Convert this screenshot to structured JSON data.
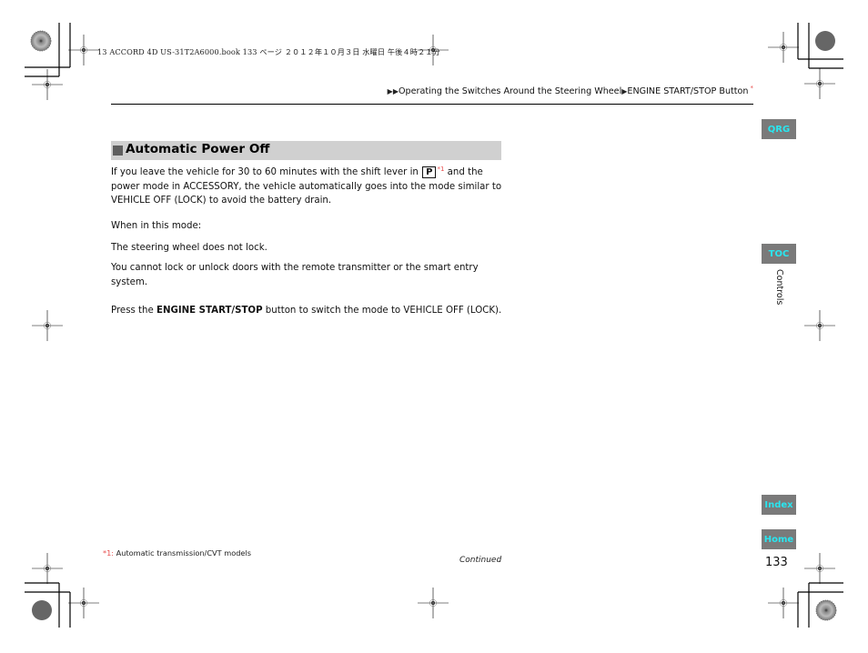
{
  "print_header": "13 ACCORD 4D US-31T2A6000.book  133 ページ  ２０１２年１０月３日  水曜日  午後４時２１分",
  "breadcrumb": {
    "arrows": "▶▶",
    "section": "Operating the Switches Around the Steering Wheel",
    "separator": "▶",
    "page": "ENGINE START/STOP Button",
    "marker": "*"
  },
  "section": {
    "title": "Automatic Power Off"
  },
  "body": {
    "p1_before": "If you leave the vehicle for 30 to 60 minutes with the shift lever in ",
    "p1_gear": "P",
    "p1_ref": "*1",
    "p1_after": " and the power mode in ACCESSORY, the vehicle automatically goes into the mode similar to VEHICLE OFF (LOCK) to avoid the battery drain.",
    "p2": "When in this mode:",
    "p3": "The steering wheel does not lock.",
    "p4": "You cannot lock or unlock doors with the remote transmitter or the smart entry system.",
    "p5_before": "Press the ",
    "p5_bold": "ENGINE START/STOP",
    "p5_after": " button to switch the mode to VEHICLE OFF (LOCK)."
  },
  "side_tabs": {
    "qrg": "QRG",
    "toc": "TOC",
    "chapter": "Controls",
    "index": "Index",
    "home": "Home"
  },
  "colors": {
    "tab_bg": "#7a7a7a",
    "tab_text": "#29e6f0",
    "section_bg": "#d0d0d0",
    "footnote_mark": "#e8504f"
  },
  "footer": {
    "footnote_mark": "*1:",
    "footnote_text": " Automatic transmission/CVT models",
    "continued": "Continued",
    "page_number": "133"
  }
}
